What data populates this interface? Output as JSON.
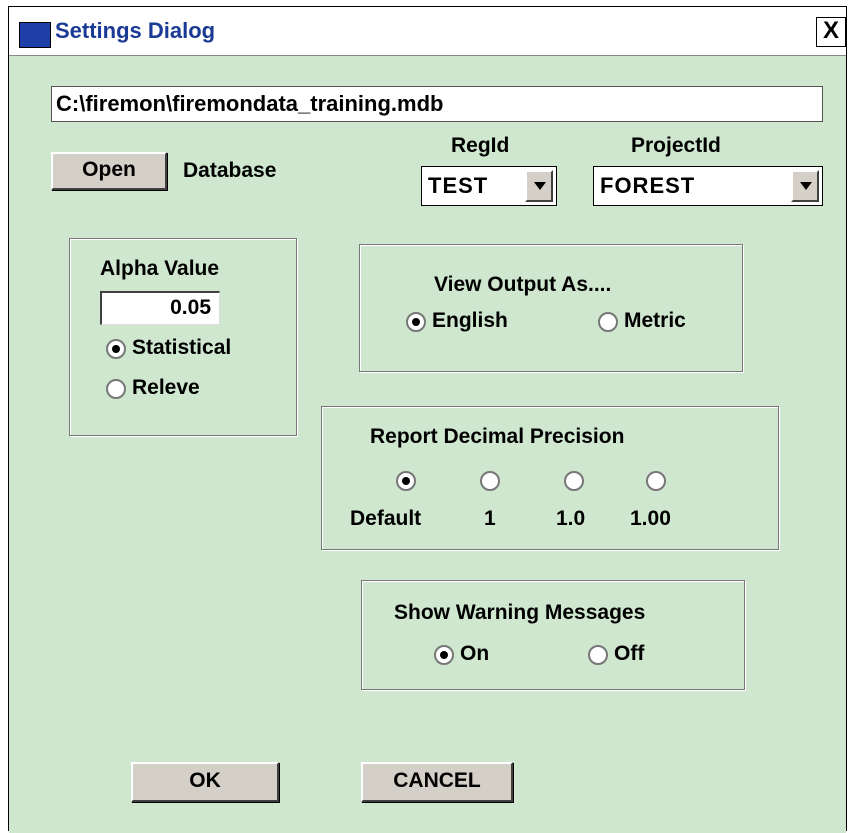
{
  "window": {
    "title": "Settings Dialog",
    "close_label": "X"
  },
  "database": {
    "path": "C:\\firemon\\firemondata_training.mdb",
    "open_label": "Open",
    "label": "Database"
  },
  "regid": {
    "label": "RegId",
    "value": "TEST"
  },
  "projectid": {
    "label": "ProjectId",
    "value": "FOREST"
  },
  "alpha": {
    "label": "Alpha Value",
    "value": "0.05",
    "options": [
      "Statistical",
      "Releve"
    ],
    "selected": "Statistical"
  },
  "view_output": {
    "label": "View Output As....",
    "options": [
      "English",
      "Metric"
    ],
    "selected": "English"
  },
  "precision": {
    "label": "Report Decimal Precision",
    "options": [
      "Default",
      "1",
      "1.0",
      "1.00"
    ],
    "selected": "Default"
  },
  "warnings": {
    "label": "Show Warning Messages",
    "options": [
      "On",
      "Off"
    ],
    "selected": "On"
  },
  "buttons": {
    "ok": "OK",
    "cancel": "CANCEL"
  }
}
